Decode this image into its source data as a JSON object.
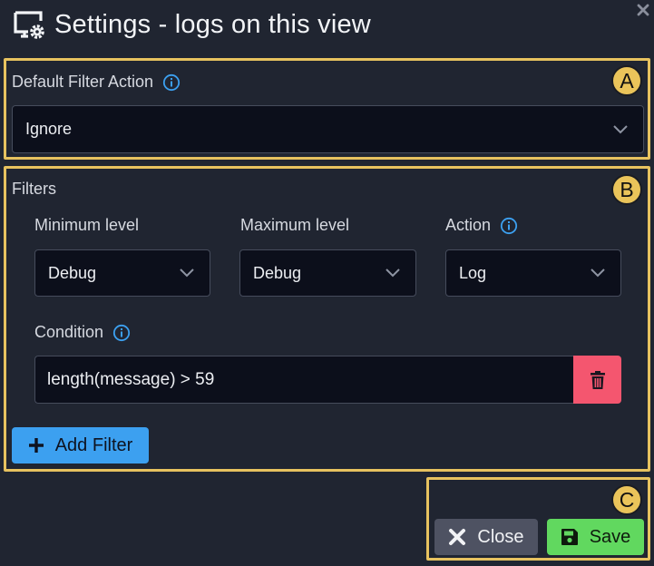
{
  "dialog": {
    "title": "Settings - logs on this view"
  },
  "markers": {
    "a": "A",
    "b": "B",
    "c": "C"
  },
  "default_filter": {
    "label": "Default Filter Action",
    "value": "Ignore"
  },
  "filters": {
    "heading": "Filters",
    "min_level_label": "Minimum level",
    "min_level_value": "Debug",
    "max_level_label": "Maximum level",
    "max_level_value": "Debug",
    "action_label": "Action",
    "action_value": "Log",
    "condition_label": "Condition",
    "condition_value": "length(message) > 59",
    "add_label": "Add Filter"
  },
  "footer": {
    "close_label": "Close",
    "save_label": "Save"
  },
  "colors": {
    "background": "#202531",
    "field_background": "#0c0f1b",
    "highlight_border": "#e7c25f",
    "info_blue": "#3ca0f0",
    "delete_red": "#f4566f",
    "save_green": "#61d85f",
    "close_gray": "#4e5262"
  },
  "icons": {
    "title": "monitor-gear-icon",
    "dismiss": "close-x-icon",
    "info": "info-circle-icon",
    "dropdown": "chevron-down-icon",
    "delete": "trash-icon",
    "add": "plus-icon",
    "close": "close-x-icon",
    "save": "floppy-disk-icon"
  }
}
